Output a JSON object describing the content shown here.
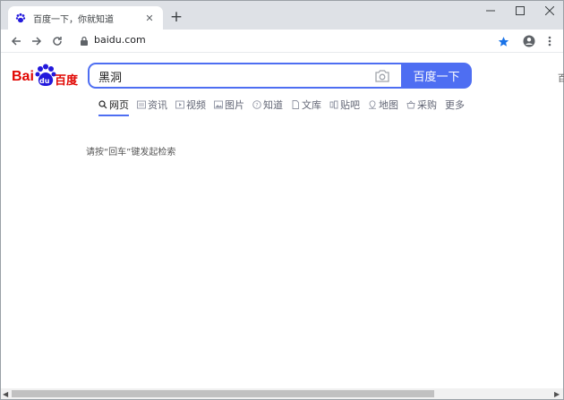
{
  "tab": {
    "title": "百度一下，你就知道",
    "close": "✕",
    "new_tab": "+"
  },
  "window_controls": {
    "minimize": "—",
    "maximize": "☐",
    "close": "✕"
  },
  "toolbar": {
    "url": "baidu.com"
  },
  "logo": {
    "left": "Bai",
    "paw": "du",
    "right": "百度"
  },
  "search": {
    "value": "黑洞",
    "button": "百度一下"
  },
  "nav": [
    {
      "label": "网页",
      "icon": "magnifier-icon",
      "active": true
    },
    {
      "label": "资讯",
      "icon": "news-icon"
    },
    {
      "label": "视频",
      "icon": "play-icon"
    },
    {
      "label": "图片",
      "icon": "image-icon"
    },
    {
      "label": "知道",
      "icon": "question-icon"
    },
    {
      "label": "文库",
      "icon": "doc-icon"
    },
    {
      "label": "贴吧",
      "icon": "tieba-icon"
    },
    {
      "label": "地图",
      "icon": "map-icon"
    },
    {
      "label": "采购",
      "icon": "basket-icon"
    },
    {
      "label": "更多",
      "icon": ""
    }
  ],
  "hint": "请按“回车”键发起检索",
  "edge_char": "百",
  "colors": {
    "accent": "#4e6ef2",
    "logo_red": "#e10602",
    "logo_blue": "#2319dc"
  }
}
